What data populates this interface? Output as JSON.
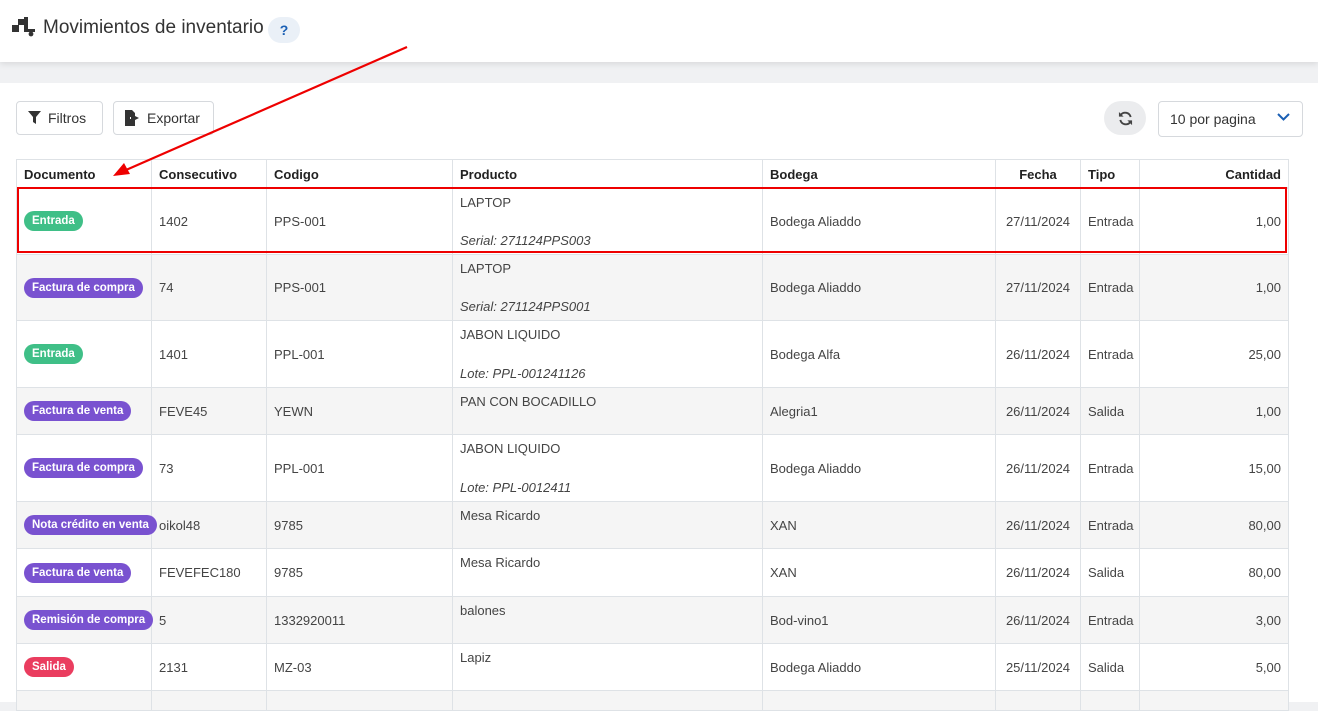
{
  "header": {
    "title": "Movimientos de inventario",
    "help_label": "?",
    "icon": "truck-boxes-icon"
  },
  "toolbar": {
    "filters_label": "Filtros",
    "export_label": "Exportar",
    "refresh_icon": "refresh-icon",
    "per_page_label": "10 por pagina"
  },
  "table": {
    "columns": [
      "Documento",
      "Consecutivo",
      "Codigo",
      "Producto",
      "Bodega",
      "Fecha",
      "Tipo",
      "Cantidad"
    ],
    "rows": [
      {
        "documento": "Entrada",
        "doc_color": "#3fbf87",
        "consecutivo": "1402",
        "codigo": "PPS-001",
        "producto": "LAPTOP",
        "detalle": "Serial: 271124PPS003",
        "bodega": "Bodega Aliaddo",
        "fecha": "27/11/2024",
        "tipo": "Entrada",
        "cantidad": "1,00"
      },
      {
        "documento": "Factura de compra",
        "doc_color": "#7952d0",
        "consecutivo": "74",
        "codigo": "PPS-001",
        "producto": "LAPTOP",
        "detalle": "Serial: 271124PPS001",
        "bodega": "Bodega Aliaddo",
        "fecha": "27/11/2024",
        "tipo": "Entrada",
        "cantidad": "1,00"
      },
      {
        "documento": "Entrada",
        "doc_color": "#3fbf87",
        "consecutivo": "1401",
        "codigo": "PPL-001",
        "producto": "JABON LIQUIDO",
        "detalle": "Lote: PPL-001241126",
        "bodega": "Bodega Alfa",
        "fecha": "26/11/2024",
        "tipo": "Entrada",
        "cantidad": "25,00"
      },
      {
        "documento": "Factura de venta",
        "doc_color": "#7952d0",
        "consecutivo": "FEVE45",
        "codigo": "YEWN",
        "producto": "PAN CON BOCADILLO",
        "detalle": "",
        "bodega": "Alegria1",
        "fecha": "26/11/2024",
        "tipo": "Salida",
        "cantidad": "1,00"
      },
      {
        "documento": "Factura de compra",
        "doc_color": "#7952d0",
        "consecutivo": "73",
        "codigo": "PPL-001",
        "producto": "JABON LIQUIDO",
        "detalle": "Lote: PPL-0012411",
        "bodega": "Bodega Aliaddo",
        "fecha": "26/11/2024",
        "tipo": "Entrada",
        "cantidad": "15,00"
      },
      {
        "documento": "Nota crédito en venta",
        "doc_color": "#7952d0",
        "consecutivo": "oikol48",
        "codigo": "9785",
        "producto": "Mesa Ricardo",
        "detalle": "",
        "bodega": "XAN",
        "fecha": "26/11/2024",
        "tipo": "Entrada",
        "cantidad": "80,00"
      },
      {
        "documento": "Factura de venta",
        "doc_color": "#7952d0",
        "consecutivo": "FEVEFEC180",
        "codigo": "9785",
        "producto": "Mesa Ricardo",
        "detalle": "",
        "bodega": "XAN",
        "fecha": "26/11/2024",
        "tipo": "Salida",
        "cantidad": "80,00"
      },
      {
        "documento": "Remisión de compra",
        "doc_color": "#7952d0",
        "consecutivo": "5",
        "codigo": "1332920011",
        "producto": "balones",
        "detalle": "",
        "bodega": "Bod-vino1",
        "fecha": "26/11/2024",
        "tipo": "Entrada",
        "cantidad": "3,00"
      },
      {
        "documento": "Salida",
        "doc_color": "#ea3d5f",
        "consecutivo": "2131",
        "codigo": "MZ-03",
        "producto": "Lapiz",
        "detalle": "",
        "bodega": "Bodega Aliaddo",
        "fecha": "25/11/2024",
        "tipo": "Salida",
        "cantidad": "5,00"
      }
    ]
  }
}
